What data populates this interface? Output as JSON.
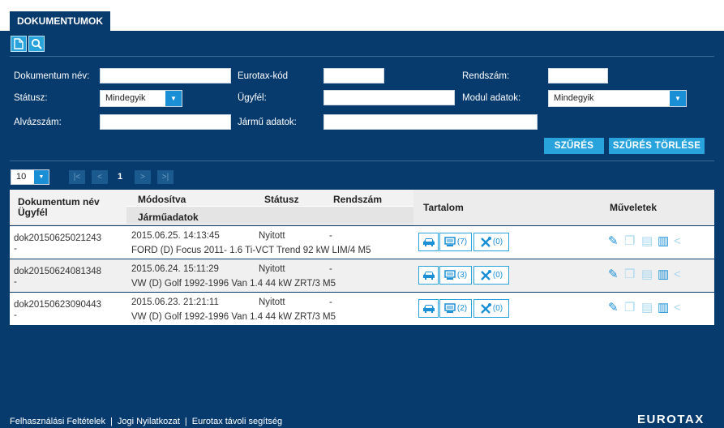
{
  "tab": {
    "title": "DOKUMENTUMOK"
  },
  "toolbar": {
    "new_icon": "document-icon",
    "search_icon": "search-icon"
  },
  "filters": {
    "dokumentum_nev": {
      "label": "Dokumentum név:",
      "value": ""
    },
    "eurotax_kod": {
      "label": "Eurotax-kód",
      "value": ""
    },
    "rendszam": {
      "label": "Rendszám:",
      "value": ""
    },
    "statusz": {
      "label": "Státusz:",
      "value": "Mindegyik"
    },
    "ugyfel": {
      "label": "Ügyfél:",
      "value": ""
    },
    "modul_adatok": {
      "label": "Modul adatok:",
      "value": "Mindegyik"
    },
    "alvazszam": {
      "label": "Alvázszám:",
      "value": ""
    },
    "jarmu_adatok": {
      "label": "Jármű adatok:",
      "value": ""
    },
    "filter_button": "SZŰRÉS",
    "clear_button": "SZŰRÉS TÖRLÉSE"
  },
  "pager": {
    "page_size": "10",
    "first": ">|",
    "prev": "<",
    "current": "1",
    "next": ">",
    "last": ">|"
  },
  "table": {
    "headers": {
      "dokumentum_nev": "Dokumentum név",
      "ugyfel": "Ügyfél",
      "modositva": "Módosítva",
      "statusz": "Státusz",
      "rendszam": "Rendszám",
      "jarmuadatok": "Járműadatok",
      "tartalom": "Tartalom",
      "muveletek": "Műveletek"
    },
    "rows": [
      {
        "name": "dok20150625021243",
        "client": "-",
        "modified": "2015.06.25. 14:13:45",
        "status": "Nyitott",
        "plate": "-",
        "vehicle": "FORD (D) Focus 2011- 1.6 Ti-VCT Trend 92 kW LIM/4 M5",
        "docs": "(7)",
        "repairs": "(0)"
      },
      {
        "name": "dok20150624081348",
        "client": "-",
        "modified": "2015.06.24. 15:11:29",
        "status": "Nyitott",
        "plate": "-",
        "vehicle": "VW (D) Golf 1992-1996 Van 1.4 44 kW ZRT/3 M5",
        "docs": "(3)",
        "repairs": "(0)"
      },
      {
        "name": "dok20150623090443",
        "client": "-",
        "modified": "2015.06.23. 21:21:11",
        "status": "Nyitott",
        "plate": "-",
        "vehicle": "VW (D) Golf 1992-1996 Van 1.4 44 kW ZRT/3 M5",
        "docs": "(2)",
        "repairs": "(0)"
      }
    ]
  },
  "footer": {
    "links": [
      "Felhasználási Feltételek",
      "Jogi Nyilatkozat",
      "Eurotax távoli segítség"
    ],
    "brand": "EUROTAX"
  },
  "colors": {
    "panel": "#073b6e",
    "accent": "#29a3dc",
    "button_text": "#ffffff"
  }
}
